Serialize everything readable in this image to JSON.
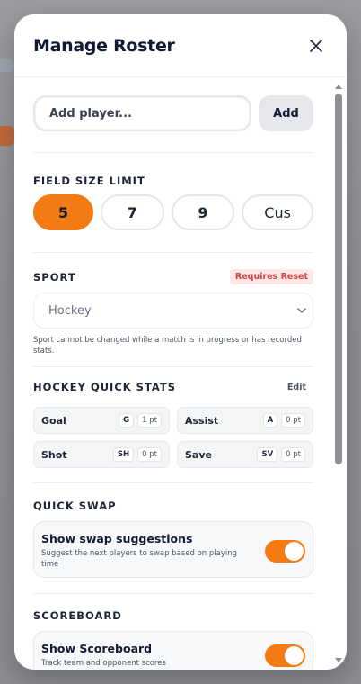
{
  "modal": {
    "title": "Manage Roster"
  },
  "add_player": {
    "placeholder": "Add player...",
    "button_label": "Add"
  },
  "field_size": {
    "label": "FIELD SIZE LIMIT",
    "options": [
      "5",
      "7",
      "9",
      "Cus"
    ],
    "selected": "5"
  },
  "sport": {
    "label": "SPORT",
    "badge": "Requires Reset",
    "selected": "Hockey",
    "note": "Sport cannot be changed while a match is in progress or has recorded stats."
  },
  "quick_stats": {
    "label": "HOCKEY QUICK STATS",
    "edit_label": "Edit",
    "items": [
      {
        "name": "Goal",
        "key": "G",
        "points": "1 pt"
      },
      {
        "name": "Assist",
        "key": "A",
        "points": "0 pt"
      },
      {
        "name": "Shot",
        "key": "SH",
        "points": "0 pt"
      },
      {
        "name": "Save",
        "key": "SV",
        "points": "0 pt"
      }
    ]
  },
  "quick_swap": {
    "label": "QUICK SWAP",
    "title": "Show swap suggestions",
    "subtitle": "Suggest the next players to swap based on playing time",
    "enabled": true
  },
  "scoreboard": {
    "label": "SCOREBOARD",
    "title": "Show Scoreboard",
    "subtitle": "Track team and opponent scores",
    "enabled": true
  },
  "colors": {
    "accent": "#f47a14",
    "title": "#111a34",
    "badge_bg": "#fde7e7",
    "badge_text": "#d2423f"
  }
}
